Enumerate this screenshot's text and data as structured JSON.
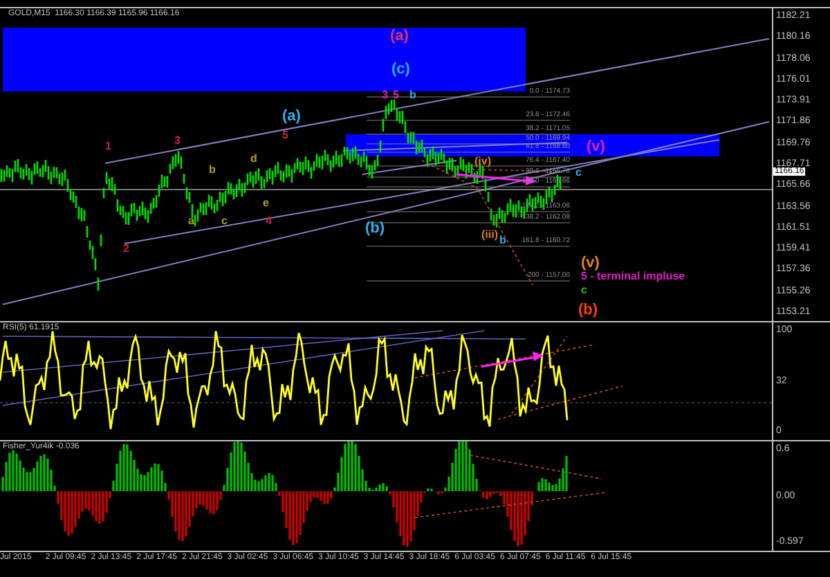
{
  "header": "GOLD,M15  1166.30 1166.39 1165.96 1166.16",
  "price_axis": [
    "1182.21",
    "1180.16",
    "1178.06",
    "1176.01",
    "1173.91",
    "1171.86",
    "1169.76",
    "1167.71",
    "1165.66",
    "1163.56",
    "1161.51",
    "1159.41",
    "1157.36",
    "1155.26",
    "1153.21"
  ],
  "current_price": "1166.16",
  "fib_levels": [
    "0.0 - 1174.73",
    "23.6 - 1172.46",
    "38.2 - 1171.05",
    "50.0 - 1169.94",
    "61.8 - 1168.80",
    "76.4 - 1167.40",
    "88.6 - 1166.78",
    "100.0 - 1165.66",
    "127.2 - 1163.06",
    "138.2 - 1162.08",
    "161.8 - 1160.72",
    "200 - 1157.00"
  ],
  "wave_labels": [
    {
      "text": "(a)",
      "color": "#e0306a"
    },
    {
      "text": "(c)",
      "color": "#30b0e8"
    },
    {
      "text": "3",
      "color": "#e020c0"
    },
    {
      "text": "5",
      "color": "#e020c0"
    },
    {
      "text": "b",
      "color": "#30b0e8"
    },
    {
      "text": "(a)",
      "color": "#30b0e8"
    },
    {
      "text": "5",
      "color": "#d02040"
    },
    {
      "text": "3",
      "color": "#d02040"
    },
    {
      "text": "1",
      "color": "#d02040"
    },
    {
      "text": "d",
      "color": "#b0a020"
    },
    {
      "text": "(iv)",
      "color": "#e08020"
    },
    {
      "text": "(v)",
      "color": "#e020c0"
    },
    {
      "text": "b",
      "color": "#b0a020"
    },
    {
      "text": "c",
      "color": "#30b0e8"
    },
    {
      "text": "e",
      "color": "#b0a020"
    },
    {
      "text": "a",
      "color": "#b0a020"
    },
    {
      "text": "c",
      "color": "#b0a020"
    },
    {
      "text": "4",
      "color": "#d02040"
    },
    {
      "text": "(b)",
      "color": "#30b0e8"
    },
    {
      "text": "(iii)",
      "color": "#e08020"
    },
    {
      "text": "b",
      "color": "#30b0e8"
    },
    {
      "text": "2",
      "color": "#d02040"
    },
    {
      "text": "(v)",
      "color": "#e08020"
    },
    {
      "text": "5 - terminal impluse",
      "color": "#e020c0"
    },
    {
      "text": "c",
      "color": "#20c020"
    },
    {
      "text": "(b)",
      "color": "#ff4000"
    }
  ],
  "rsi": {
    "title": "RSI(5) 61.1915",
    "ticks": [
      "100",
      "32",
      "0"
    ]
  },
  "fisher": {
    "title": "Fisher_Yur4ik -0.036",
    "ticks": [
      "0.6",
      "0.00",
      "-0.597"
    ]
  },
  "time_axis": [
    "Jul 2015",
    "2 Jul 09:45",
    "2 Jul 13:45",
    "2 Jul 17:45",
    "2 Jul 21:45",
    "3 Jul 02:45",
    "3 Jul 06:45",
    "3 Jul 10:45",
    "3 Jul 14:45",
    "3 Jul 18:45",
    "6 Jul 03:45",
    "6 Jul 07:45",
    "6 Jul 11:45",
    "6 Jul 15:45"
  ]
}
